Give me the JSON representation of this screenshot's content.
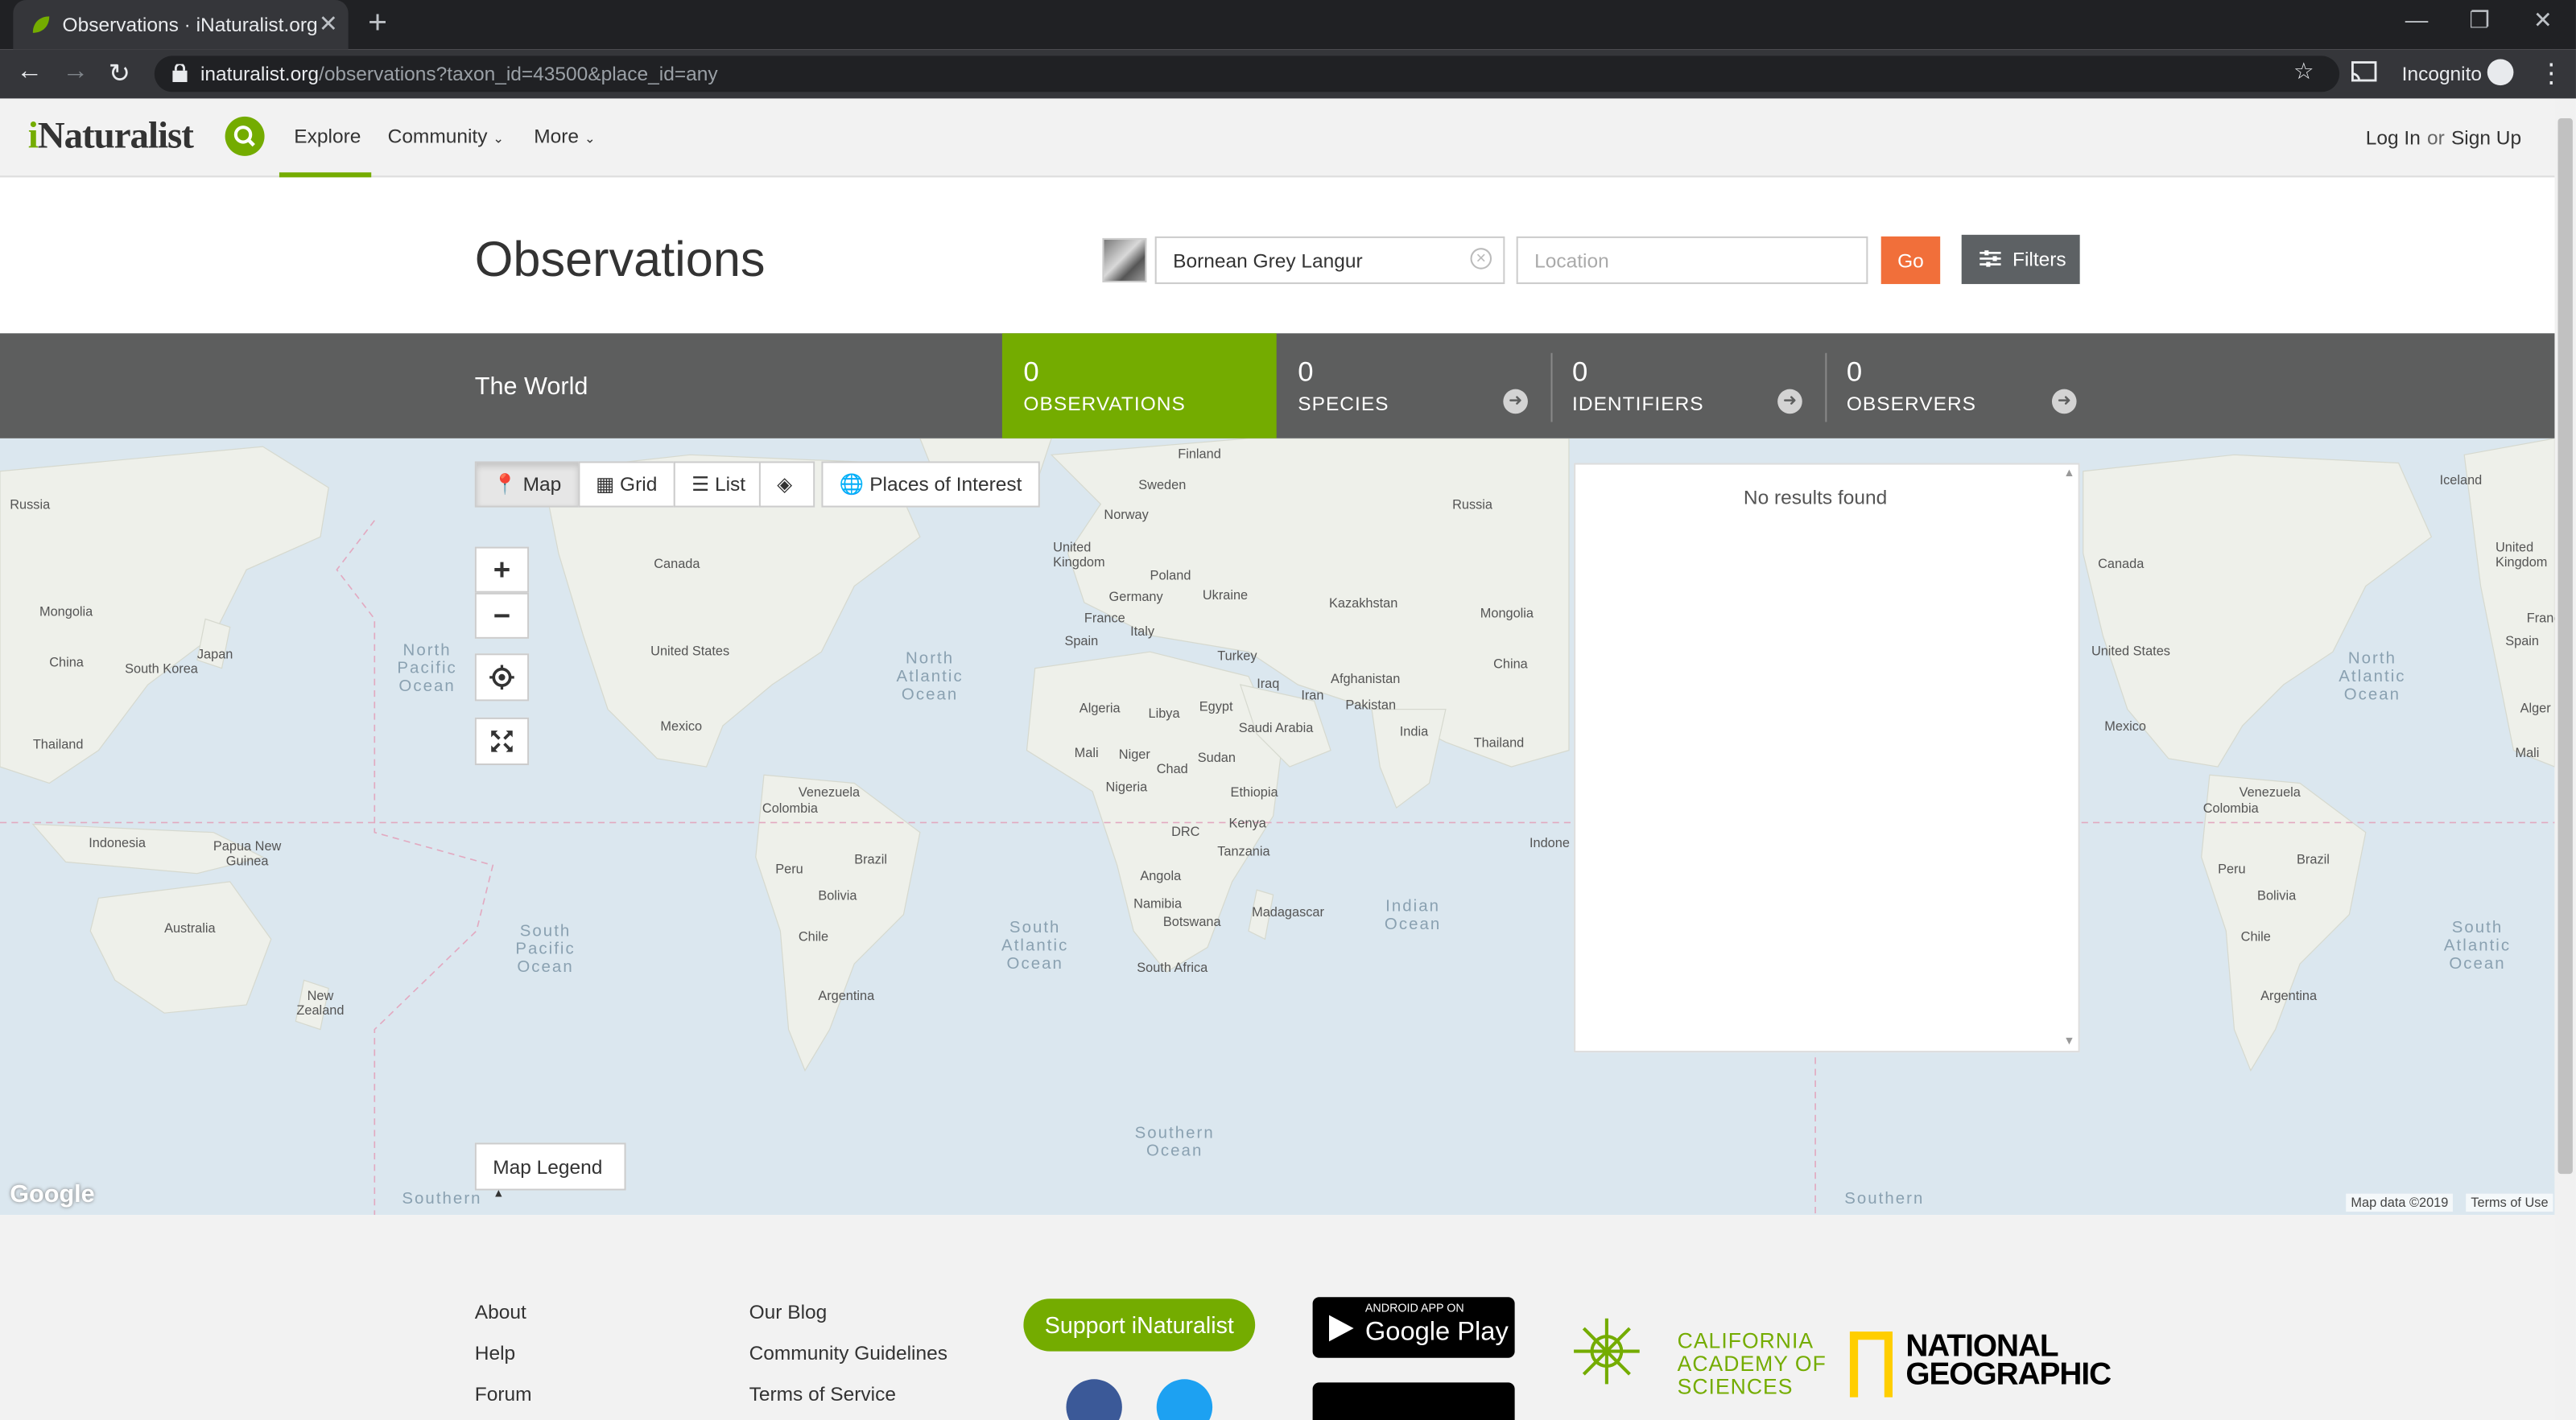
{
  "browser": {
    "tab_title": "Observations · iNaturalist.org",
    "url_host": "inaturalist.org",
    "url_path": "/observations?taxon_id=43500&place_id=any",
    "profile_label": "Incognito"
  },
  "header": {
    "logo_i": "i",
    "logo_rest": "Naturalist",
    "nav": [
      {
        "label": "Explore"
      },
      {
        "label": "Community"
      },
      {
        "label": "More"
      }
    ],
    "login": "Log In",
    "or": "or",
    "signup": "Sign Up"
  },
  "search": {
    "title": "Observations",
    "taxon_value": "Bornean Grey Langur",
    "location_placeholder": "Location",
    "go_label": "Go",
    "filters_label": "Filters"
  },
  "stats": {
    "place": "The World",
    "items": [
      {
        "count": "0",
        "label": "OBSERVATIONS"
      },
      {
        "count": "0",
        "label": "SPECIES"
      },
      {
        "count": "0",
        "label": "IDENTIFIERS"
      },
      {
        "count": "0",
        "label": "OBSERVERS"
      }
    ]
  },
  "map": {
    "view_buttons": [
      {
        "label": "Map",
        "icon": "map-marker-icon"
      },
      {
        "label": "Grid",
        "icon": "grid-icon"
      },
      {
        "label": "List",
        "icon": "list-icon"
      },
      {
        "label": "",
        "icon": "layers-icon"
      },
      {
        "label": "Places of Interest",
        "icon": "globe-icon"
      }
    ],
    "no_results": "No results found",
    "legend_label": "Map Legend",
    "google": "Google",
    "map_data": "Map data ©2019",
    "terms": "Terms of Use",
    "labels": [
      "Russia",
      "Mongolia",
      "China",
      "South Korea",
      "Japan",
      "Thailand",
      "Indonesia",
      "Papua New Guinea",
      "Australia",
      "New Zealand",
      "Canada",
      "United States",
      "Mexico",
      "Venezuela",
      "Colombia",
      "Peru",
      "Brazil",
      "Bolivia",
      "Chile",
      "Argentina",
      "Finland",
      "Sweden",
      "Norway",
      "United Kingdom",
      "Poland",
      "Germany",
      "Ukraine",
      "France",
      "Italy",
      "Spain",
      "Turkey",
      "Kazakhstan",
      "Mongolia",
      "Russia",
      "Iraq",
      "Iran",
      "Afghanistan",
      "Pakistan",
      "India",
      "Thailand",
      "China",
      "Algeria",
      "Libya",
      "Egypt",
      "Saudi Arabia",
      "Mali",
      "Niger",
      "Chad",
      "Sudan",
      "Nigeria",
      "Ethiopia",
      "Kenya",
      "DRC",
      "Tanzania",
      "Angola",
      "Namibia",
      "Botswana",
      "Madagascar",
      "South Africa",
      "Iceland",
      "United Kingdom",
      "Canada",
      "United States",
      "Mexico",
      "Spain",
      "Franc",
      "Alger",
      "Mali",
      "Venezuela",
      "Colombia",
      "Peru",
      "Brazil",
      "Bolivia",
      "Chile",
      "Argentina",
      "Indone"
    ],
    "oceans": [
      "North Pacific Ocean",
      "North Atlantic Ocean",
      "South Pacific Ocean",
      "South Atlantic Ocean",
      "Indian Ocean",
      "Southern Ocean",
      "North Atlantic Ocean",
      "South Atlantic Ocean",
      "Southern",
      "Southern"
    ]
  },
  "footer": {
    "col1": [
      "About",
      "Help",
      "Forum"
    ],
    "col2": [
      "Our Blog",
      "Community Guidelines",
      "Terms of Service"
    ],
    "support": "Support iNaturalist",
    "gplay_small": "ANDROID APP ON",
    "gplay_big": "Google Play",
    "cas": [
      "CALIFORNIA",
      "ACADEMY OF",
      "SCIENCES"
    ],
    "natgeo": [
      "NATIONAL",
      "GEOGRAPHIC"
    ]
  },
  "colors": {
    "brand_green": "#74ac00",
    "go_orange": "#f16f3a",
    "stats_bg": "#5d5e5e"
  }
}
